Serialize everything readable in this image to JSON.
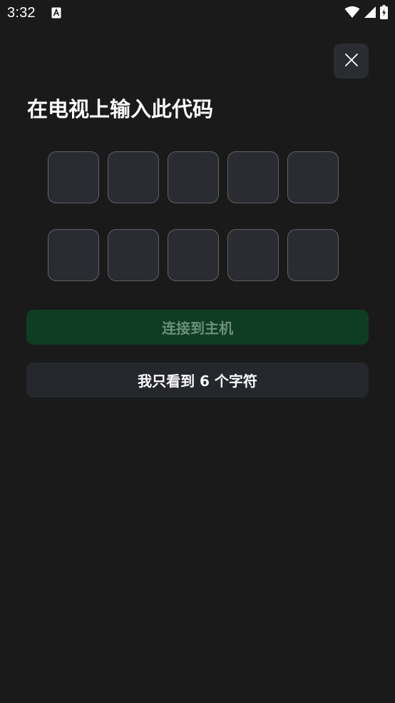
{
  "status_bar": {
    "time": "3:32",
    "icons": [
      "notification-a-icon",
      "wifi-icon",
      "signal-icon",
      "battery-charging-icon"
    ]
  },
  "close_button": {
    "icon": "close-icon"
  },
  "title": "在电视上输入此代码",
  "code_rows": [
    [
      "",
      "",
      "",
      "",
      ""
    ],
    [
      "",
      "",
      "",
      "",
      ""
    ]
  ],
  "buttons": {
    "connect_label": "连接到主机",
    "six_chars_label": "我只看到 6 个字符"
  },
  "colors": {
    "background": "#1a1a1b",
    "box_fill": "#2a2c31",
    "box_border": "#5d616b",
    "connect_disabled_bg": "#0f3d24",
    "connect_disabled_text": "#6b8f78",
    "secondary_button_bg": "#25272c"
  }
}
